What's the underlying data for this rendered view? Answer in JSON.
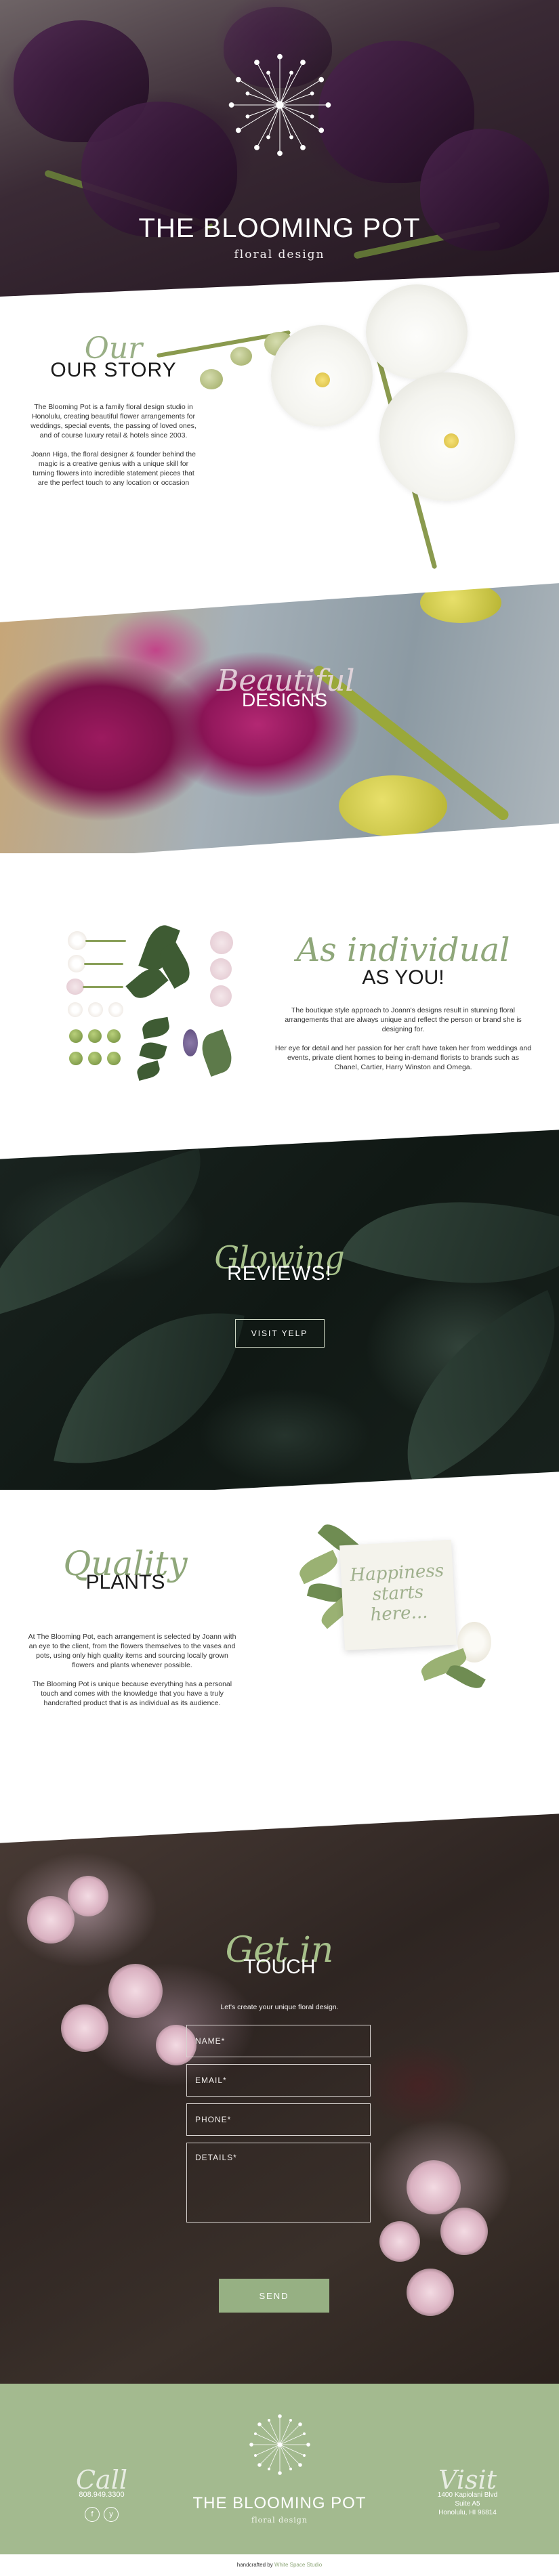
{
  "brand": {
    "name": "THE BLOOMING POT",
    "tagline": "floral design"
  },
  "story": {
    "script": "Our",
    "heading": "OUR STORY",
    "paragraph1": "The Blooming Pot is a family floral design studio in Honolulu, creating beautiful flower arrangements for weddings, special events, the passing of loved ones, and of course luxury retail & hotels since 2003.",
    "paragraph2": "Joann Higa, the floral designer & founder behind the magic is a creative genius with a unique skill for turning flowers into incredible statement pieces that are the perfect touch to any location or occasion"
  },
  "designs": {
    "script": "Beautiful",
    "heading": "DESIGNS"
  },
  "individual": {
    "script": "As individual",
    "heading": "AS YOU!",
    "paragraph1": "The boutique style approach to Joann's designs result in stunning floral arrangements that are always unique and reflect the person or brand she is designing for.",
    "paragraph2": "Her eye for detail and her passion for her craft have taken her from weddings and events, private client homes to being in-demand florists to brands such as Chanel, Cartier, Harry Winston and Omega."
  },
  "reviews": {
    "script": "Glowing",
    "heading": "REVIEWS!",
    "button_label": "VISIT YELP"
  },
  "plants": {
    "script": "Quality",
    "heading": "PLANTS",
    "paragraph1": "At The Blooming Pot, each arrangement is selected by Joann with an eye to the client, from the flowers themselves to the vases and pots, using only high quality items and sourcing locally grown flowers and plants whenever possible.",
    "paragraph2": "The Blooming Pot is unique because everything has a personal touch and comes with the knowledge that you have a truly handcrafted product that is as individual as its audience.",
    "card_text": "Happiness starts here..."
  },
  "touch": {
    "script": "Get in",
    "heading": "TOUCH",
    "subtitle": "Let's create your unique floral design.",
    "name_placeholder": "NAME*",
    "email_placeholder": "EMAIL*",
    "phone_placeholder": "PHONE*",
    "details_placeholder": "DETAILS*",
    "send_label": "SEND"
  },
  "footer": {
    "call_script": "Call",
    "phone": "808.949.3300",
    "visit_script": "Visit",
    "address_line1": "1400 Kapiolani Blvd",
    "address_line2": "Suite A5",
    "address_line3": "Honolulu, HI 96814",
    "social": [
      {
        "icon": "facebook-icon",
        "glyph": "f"
      },
      {
        "icon": "yelp-icon",
        "glyph": "y"
      }
    ]
  },
  "credits": {
    "prefix": "handcrafted by",
    "studio": "White Space Studio"
  },
  "colors": {
    "accent_green": "#8fa77a",
    "footer_green": "#a3ba8f",
    "button_green": "#96b083"
  }
}
